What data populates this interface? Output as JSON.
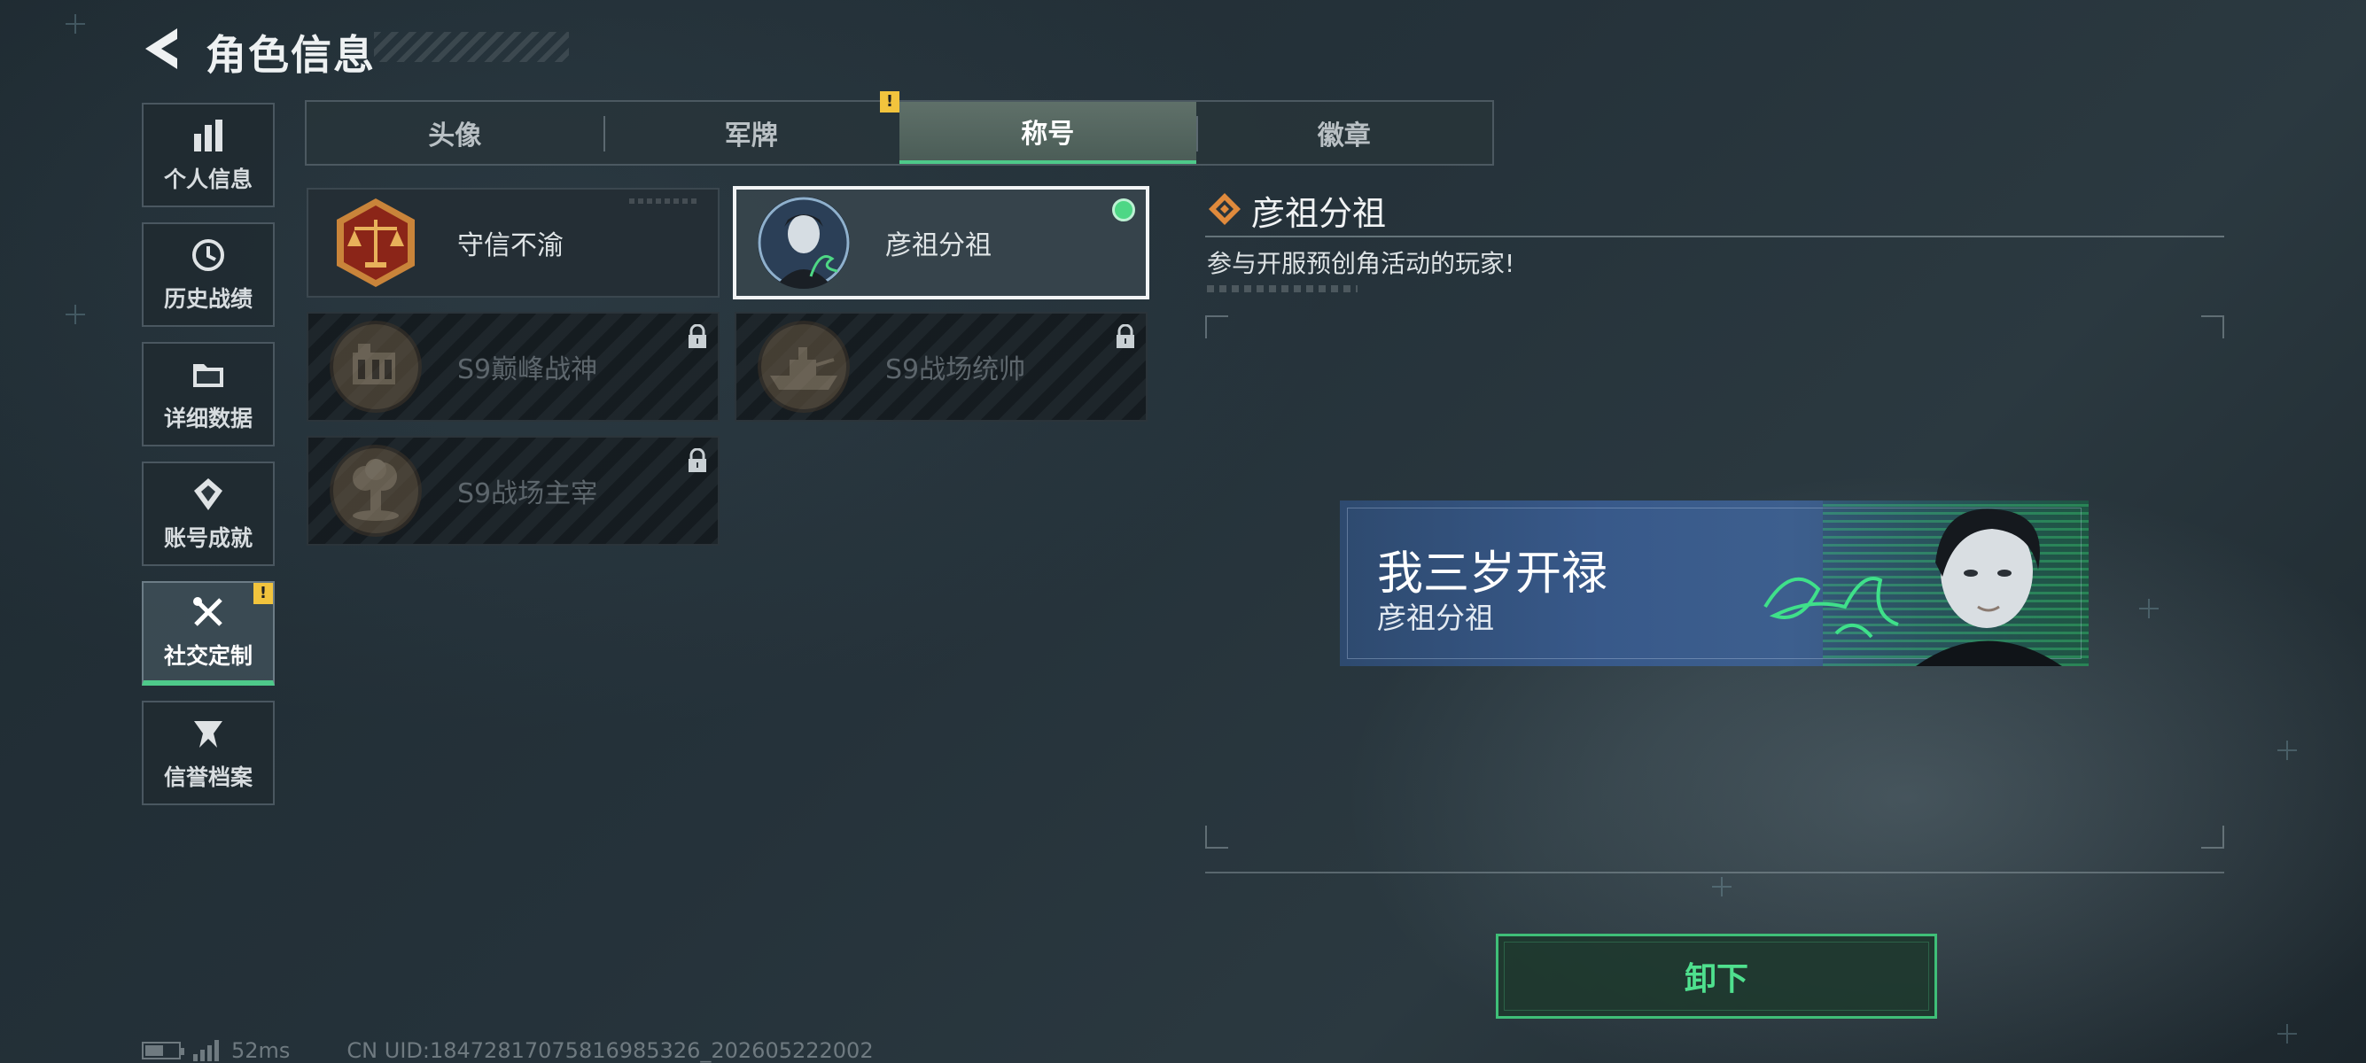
{
  "header": {
    "title": "角色信息"
  },
  "sidebar": {
    "items": [
      {
        "label": "个人信息",
        "icon": "bar-chart-icon"
      },
      {
        "label": "历史战绩",
        "icon": "history-clock-icon"
      },
      {
        "label": "详细数据",
        "icon": "folder-icon"
      },
      {
        "label": "账号成就",
        "icon": "achievement-icon"
      },
      {
        "label": "社交定制",
        "icon": "tools-icon",
        "active": true,
        "alert": "!"
      },
      {
        "label": "信誉档案",
        "icon": "reputation-icon"
      }
    ]
  },
  "tabs": [
    {
      "label": "头像"
    },
    {
      "label": "军牌",
      "alert": "!"
    },
    {
      "label": "称号",
      "active": true
    },
    {
      "label": "徽章"
    }
  ],
  "titles": [
    {
      "label": "守信不渝",
      "icon": "scales-medal-icon",
      "locked": false,
      "selected": false
    },
    {
      "label": "彦祖分祖",
      "icon": "portrait-medal-icon",
      "locked": false,
      "selected": true,
      "equipped": true
    },
    {
      "label": "S9巅峰战神",
      "icon": "building-medal-icon",
      "locked": true
    },
    {
      "label": "S9战场统帅",
      "icon": "warship-medal-icon",
      "locked": true
    },
    {
      "label": "S9战场主宰",
      "icon": "explosion-medal-icon",
      "locked": true
    }
  ],
  "detail": {
    "name": "彦祖分祖",
    "description": "参与开服预创角活动的玩家!"
  },
  "banner": {
    "title": "我三岁开禄",
    "subtitle": "彦祖分祖"
  },
  "action": {
    "unequip_label": "卸下"
  },
  "status": {
    "battery_level": 0.5,
    "latency": "52ms",
    "uid": "CN UID:18472817075816985326_202605222002"
  },
  "colors": {
    "accent_green": "#4ec98a",
    "alert_yellow": "#f2c43d",
    "equipped_dot": "#4ed785"
  }
}
